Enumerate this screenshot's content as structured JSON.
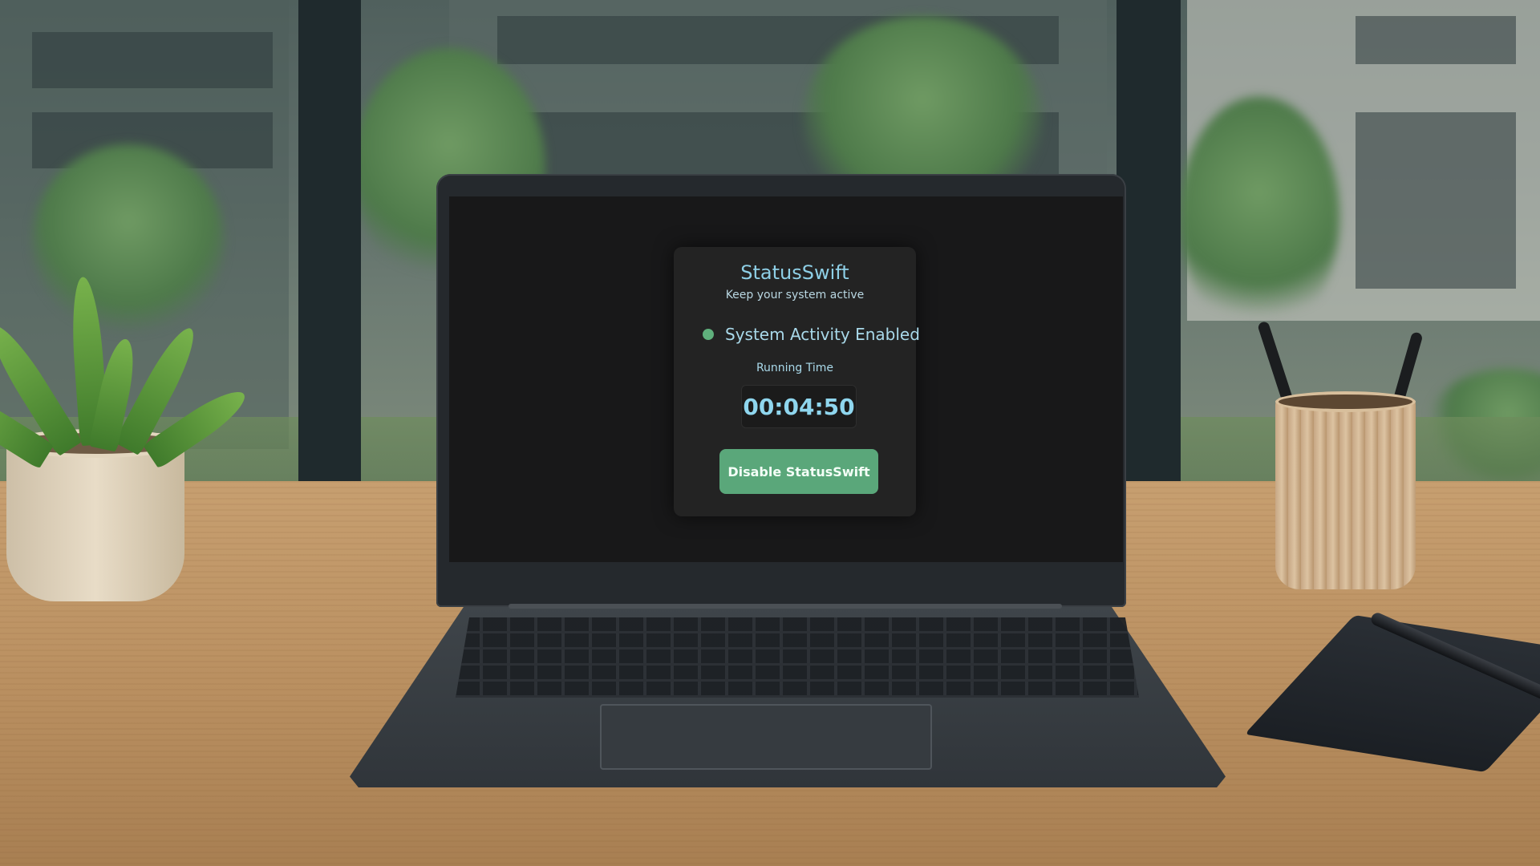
{
  "app": {
    "title": "StatusSwift",
    "subtitle": "Keep your system active",
    "status_text": "System Activity Enabled",
    "status_color": "#5fb07c",
    "timer_label": "Running Time",
    "timer_value": "00:04:50",
    "button_label": "Disable StatusSwift",
    "accent_color": "#8ecfe6",
    "button_color": "#5aa77a"
  },
  "scene": {
    "objects": [
      "potted-plant",
      "laptop",
      "pencil-cup",
      "notebook",
      "pen"
    ]
  }
}
